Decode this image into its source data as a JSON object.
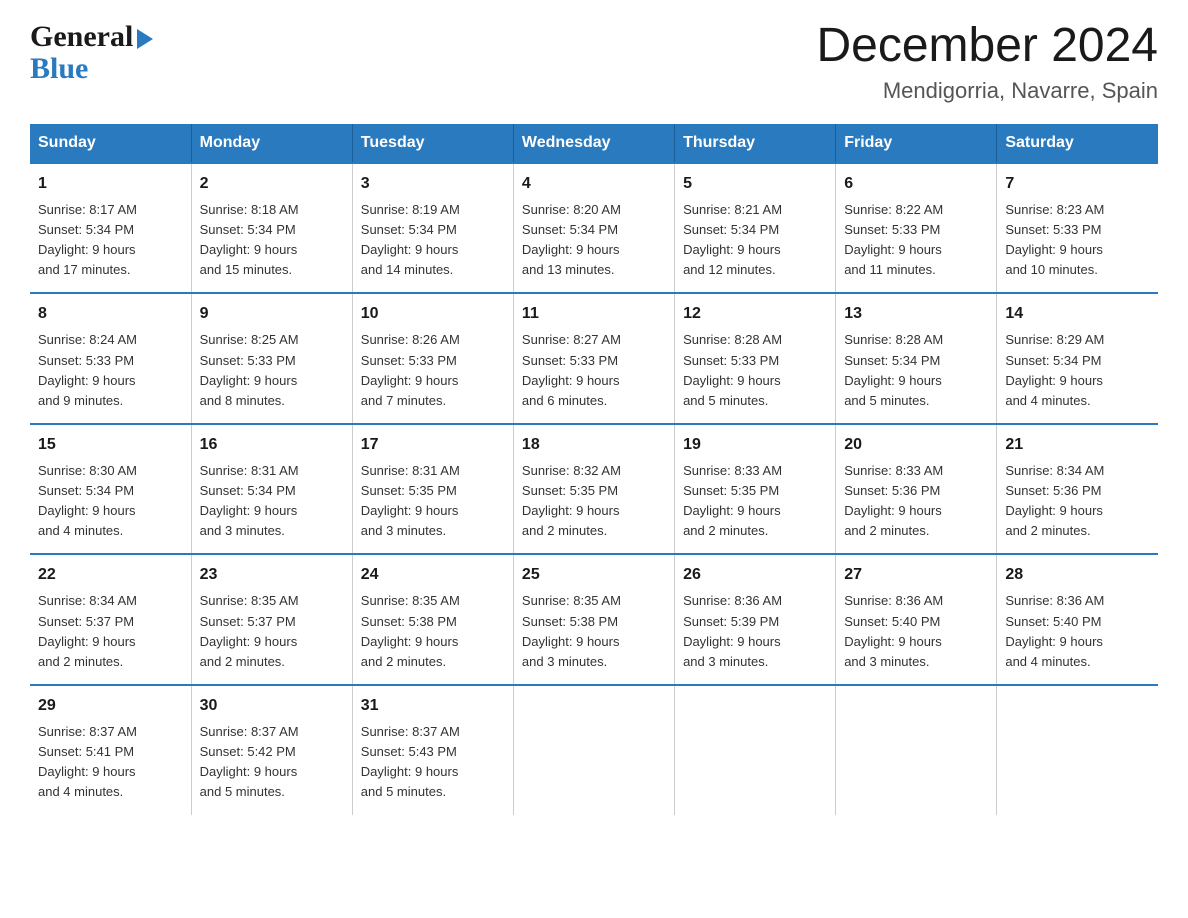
{
  "logo": {
    "line1": "General",
    "arrow": "▶",
    "line2": "Blue"
  },
  "title": "December 2024",
  "subtitle": "Mendigorria, Navarre, Spain",
  "days_of_week": [
    "Sunday",
    "Monday",
    "Tuesday",
    "Wednesday",
    "Thursday",
    "Friday",
    "Saturday"
  ],
  "weeks": [
    [
      {
        "day": "1",
        "sunrise": "8:17 AM",
        "sunset": "5:34 PM",
        "daylight": "9 hours and 17 minutes."
      },
      {
        "day": "2",
        "sunrise": "8:18 AM",
        "sunset": "5:34 PM",
        "daylight": "9 hours and 15 minutes."
      },
      {
        "day": "3",
        "sunrise": "8:19 AM",
        "sunset": "5:34 PM",
        "daylight": "9 hours and 14 minutes."
      },
      {
        "day": "4",
        "sunrise": "8:20 AM",
        "sunset": "5:34 PM",
        "daylight": "9 hours and 13 minutes."
      },
      {
        "day": "5",
        "sunrise": "8:21 AM",
        "sunset": "5:34 PM",
        "daylight": "9 hours and 12 minutes."
      },
      {
        "day": "6",
        "sunrise": "8:22 AM",
        "sunset": "5:33 PM",
        "daylight": "9 hours and 11 minutes."
      },
      {
        "day": "7",
        "sunrise": "8:23 AM",
        "sunset": "5:33 PM",
        "daylight": "9 hours and 10 minutes."
      }
    ],
    [
      {
        "day": "8",
        "sunrise": "8:24 AM",
        "sunset": "5:33 PM",
        "daylight": "9 hours and 9 minutes."
      },
      {
        "day": "9",
        "sunrise": "8:25 AM",
        "sunset": "5:33 PM",
        "daylight": "9 hours and 8 minutes."
      },
      {
        "day": "10",
        "sunrise": "8:26 AM",
        "sunset": "5:33 PM",
        "daylight": "9 hours and 7 minutes."
      },
      {
        "day": "11",
        "sunrise": "8:27 AM",
        "sunset": "5:33 PM",
        "daylight": "9 hours and 6 minutes."
      },
      {
        "day": "12",
        "sunrise": "8:28 AM",
        "sunset": "5:33 PM",
        "daylight": "9 hours and 5 minutes."
      },
      {
        "day": "13",
        "sunrise": "8:28 AM",
        "sunset": "5:34 PM",
        "daylight": "9 hours and 5 minutes."
      },
      {
        "day": "14",
        "sunrise": "8:29 AM",
        "sunset": "5:34 PM",
        "daylight": "9 hours and 4 minutes."
      }
    ],
    [
      {
        "day": "15",
        "sunrise": "8:30 AM",
        "sunset": "5:34 PM",
        "daylight": "9 hours and 4 minutes."
      },
      {
        "day": "16",
        "sunrise": "8:31 AM",
        "sunset": "5:34 PM",
        "daylight": "9 hours and 3 minutes."
      },
      {
        "day": "17",
        "sunrise": "8:31 AM",
        "sunset": "5:35 PM",
        "daylight": "9 hours and 3 minutes."
      },
      {
        "day": "18",
        "sunrise": "8:32 AM",
        "sunset": "5:35 PM",
        "daylight": "9 hours and 2 minutes."
      },
      {
        "day": "19",
        "sunrise": "8:33 AM",
        "sunset": "5:35 PM",
        "daylight": "9 hours and 2 minutes."
      },
      {
        "day": "20",
        "sunrise": "8:33 AM",
        "sunset": "5:36 PM",
        "daylight": "9 hours and 2 minutes."
      },
      {
        "day": "21",
        "sunrise": "8:34 AM",
        "sunset": "5:36 PM",
        "daylight": "9 hours and 2 minutes."
      }
    ],
    [
      {
        "day": "22",
        "sunrise": "8:34 AM",
        "sunset": "5:37 PM",
        "daylight": "9 hours and 2 minutes."
      },
      {
        "day": "23",
        "sunrise": "8:35 AM",
        "sunset": "5:37 PM",
        "daylight": "9 hours and 2 minutes."
      },
      {
        "day": "24",
        "sunrise": "8:35 AM",
        "sunset": "5:38 PM",
        "daylight": "9 hours and 2 minutes."
      },
      {
        "day": "25",
        "sunrise": "8:35 AM",
        "sunset": "5:38 PM",
        "daylight": "9 hours and 3 minutes."
      },
      {
        "day": "26",
        "sunrise": "8:36 AM",
        "sunset": "5:39 PM",
        "daylight": "9 hours and 3 minutes."
      },
      {
        "day": "27",
        "sunrise": "8:36 AM",
        "sunset": "5:40 PM",
        "daylight": "9 hours and 3 minutes."
      },
      {
        "day": "28",
        "sunrise": "8:36 AM",
        "sunset": "5:40 PM",
        "daylight": "9 hours and 4 minutes."
      }
    ],
    [
      {
        "day": "29",
        "sunrise": "8:37 AM",
        "sunset": "5:41 PM",
        "daylight": "9 hours and 4 minutes."
      },
      {
        "day": "30",
        "sunrise": "8:37 AM",
        "sunset": "5:42 PM",
        "daylight": "9 hours and 5 minutes."
      },
      {
        "day": "31",
        "sunrise": "8:37 AM",
        "sunset": "5:43 PM",
        "daylight": "9 hours and 5 minutes."
      },
      null,
      null,
      null,
      null
    ]
  ],
  "labels": {
    "sunrise": "Sunrise:",
    "sunset": "Sunset:",
    "daylight": "Daylight:"
  }
}
